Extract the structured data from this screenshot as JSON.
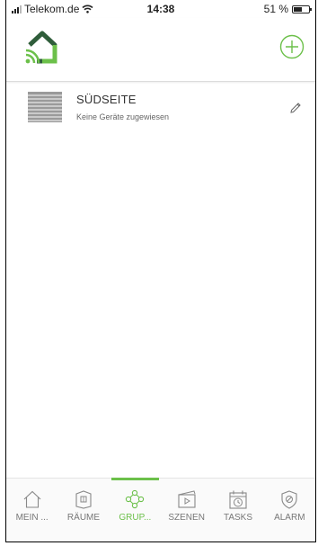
{
  "status_bar": {
    "carrier": "Telekom.de",
    "time": "14:38",
    "battery": "51 %",
    "battery_level": 0.51
  },
  "header": {
    "logo_icon": "home-wifi-logo-icon",
    "add_icon": "plus-circle-icon"
  },
  "groups": [
    {
      "name": "SÜDSEITE",
      "subtitle": "Keine Geräte zugewiesen",
      "thumb_icon": "blinds-icon",
      "action_icon": "pencil-icon"
    }
  ],
  "tabs": [
    {
      "label": "MEIN ...",
      "icon": "house-icon",
      "active": false
    },
    {
      "label": "RÄUME",
      "icon": "room-icon",
      "active": false
    },
    {
      "label": "GRUP...",
      "icon": "group-icon",
      "active": true
    },
    {
      "label": "SZENEN",
      "icon": "scene-icon",
      "active": false
    },
    {
      "label": "TASKS",
      "icon": "calendar-clock-icon",
      "active": false
    },
    {
      "label": "ALARM",
      "icon": "shield-icon",
      "active": false
    }
  ],
  "colors": {
    "accent": "#6cc04a",
    "logo_dark": "#2f5d3a"
  }
}
